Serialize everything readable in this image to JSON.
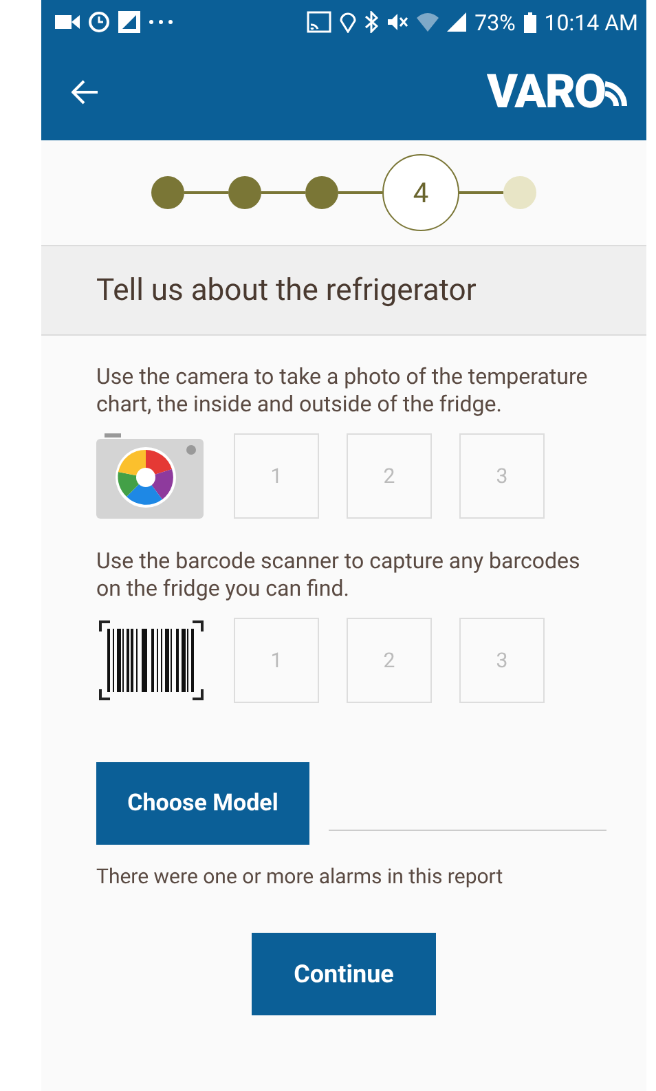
{
  "status_bar": {
    "battery": "73%",
    "time": "10:14 AM"
  },
  "toolbar": {
    "logo": "VARO"
  },
  "steps": [
    {
      "done": true,
      "current": false
    },
    {
      "done": true,
      "current": false
    },
    {
      "done": true,
      "current": false
    },
    {
      "label": "4",
      "done": false,
      "current": true
    },
    {
      "done": false,
      "current": false
    }
  ],
  "section_title": "Tell us about the refrigerator",
  "capture_groups": [
    {
      "kind": "camera",
      "instructions": "Use the camera to take a photo of the temperature chart, the inside and outside of the fridge.",
      "slots": [
        "1",
        "2",
        "3"
      ]
    },
    {
      "kind": "barcode",
      "instructions": "Use the barcode scanner to capture any barcodes on the fridge you can find.",
      "slots": [
        "1",
        "2",
        "3"
      ]
    }
  ],
  "choose_model_button": "Choose Model",
  "alarm_note": "There were one or more alarms in this report",
  "continue_button": "Continue"
}
